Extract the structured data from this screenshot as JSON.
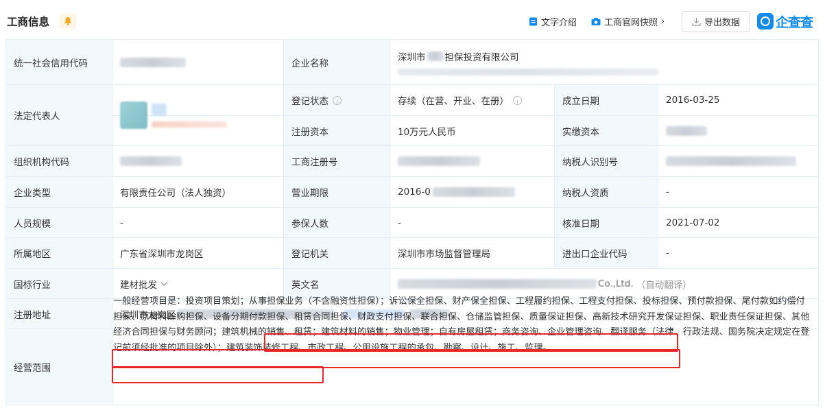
{
  "header": {
    "title": "工商信息",
    "text_intro": "文字介绍",
    "snapshot": "工商官网快照",
    "export": "导出数据",
    "brand": "企查查"
  },
  "labels": {
    "credit_code": "统一社会信用代码",
    "company_name": "企业名称",
    "legal_rep": "法定代表人",
    "reg_status": "登记状态",
    "established": "成立日期",
    "reg_capital": "注册资本",
    "paid_capital": "实缴资本",
    "org_code": "组织机构代码",
    "biz_reg_no": "工商注册号",
    "taxpayer_id": "纳税人识别号",
    "company_type": "企业类型",
    "biz_term": "营业期限",
    "taxpayer_qual": "纳税人资质",
    "staff_size": "人员规模",
    "insured": "参保人数",
    "approved_date": "核准日期",
    "region": "所属地区",
    "reg_authority": "登记机关",
    "import_export_code": "进出口企业代码",
    "industry": "国标行业",
    "english_name": "英文名",
    "reg_address": "注册地址",
    "business_scope": "经营范围"
  },
  "values": {
    "company_name_prefix": "深圳市",
    "company_name_suffix": "担保投资有限公司",
    "reg_status": "存续（在营、开业、在册）",
    "established": "2016-03-25",
    "reg_capital": "10万元人民币",
    "company_type": "有限责任公司（法人独资）",
    "biz_term_prefix": "2016-0",
    "taxpayer_qual": "-",
    "staff_size": "-",
    "insured": "-",
    "approved_date": "2021-07-02",
    "region": "广东省深圳市龙岗区",
    "reg_authority": "深圳市市场监督管理局",
    "import_export_code": "-",
    "industry": "建材批发",
    "english_suffix": "Co.,Ltd.",
    "english_note": "（自动翻译）",
    "reg_address_prefix": "深圳市龙岗区"
  },
  "business_scope": "一般经营项目是：投资项目策划；从事担保业务（不含融资性担保）；诉讼保全担保、财产保全担保、工程履约担保、工程支付担保、投标担保、预付款担保、尾付款如约偿付担保、原材料赊购担保、设备分期付款担保、租赁合同担保、财政支付担保、联合担保、仓储监管担保、质量保证担保、高新技术研究开发保证担保、职业责任保证担保、其他经济合同担保与财务顾问；建筑机械的销售、租赁；建筑材料的销售；物业管理；自有房屋租赁；商务咨询、企业管理咨询、翻译服务（法律、行政法规、国务院决定规定在登记前须经批准的项目除外）；建筑装饰装修工程、市政工程、公用设施工程的承包、勘察、设计、施工、监理。",
  "colors": {
    "label_bg": "#f2f9fc",
    "border": "#e4eef6",
    "brand": "#128bed",
    "highlight": "#e8272b"
  }
}
